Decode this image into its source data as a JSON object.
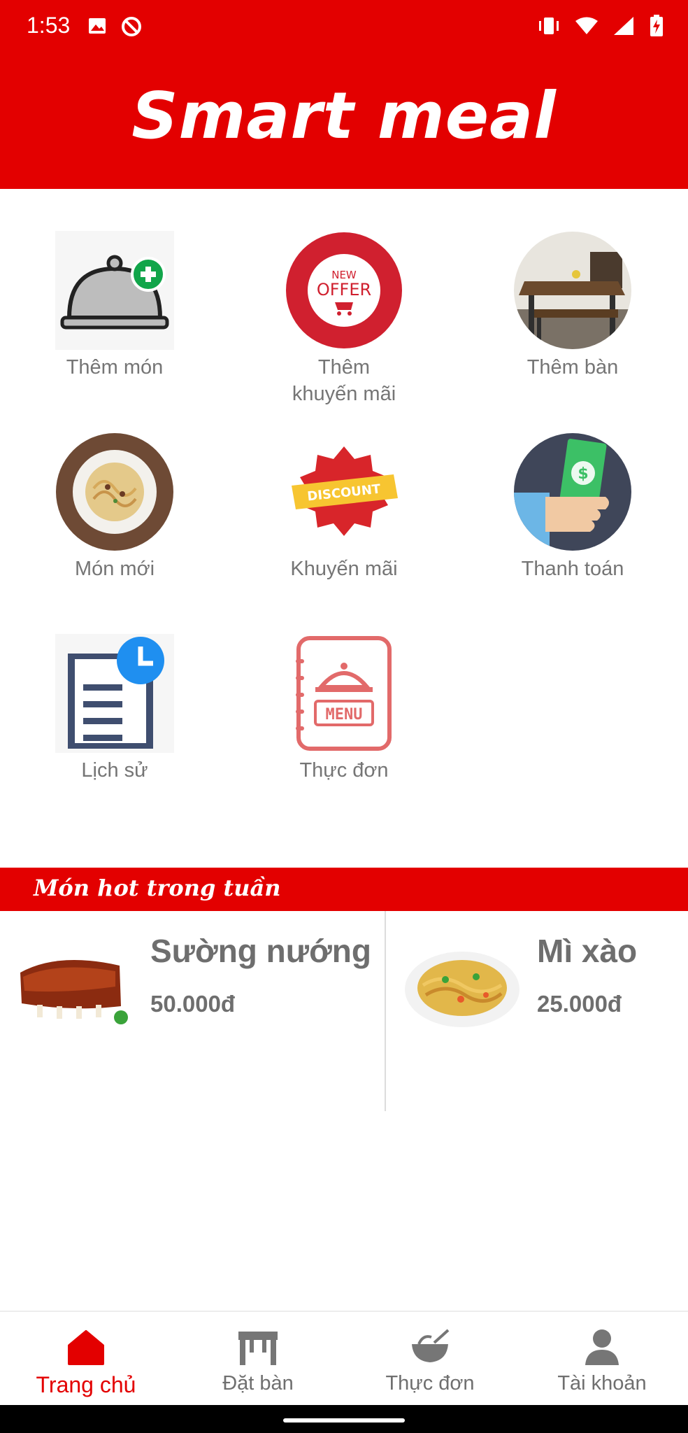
{
  "status": {
    "time": "1:53"
  },
  "app": {
    "title": "Smart meal"
  },
  "features": [
    {
      "label": "Thêm món",
      "icon": "covered-dish-add-icon"
    },
    {
      "label": "Thêm\nkhuyến mãi",
      "icon": "new-offer-icon"
    },
    {
      "label": "Thêm bàn",
      "icon": "dining-table-icon"
    },
    {
      "label": "Món mới",
      "icon": "noodle-plate-icon"
    },
    {
      "label": "Khuyến mãi",
      "icon": "discount-badge-icon"
    },
    {
      "label": "Thanh toán",
      "icon": "payment-cash-icon"
    },
    {
      "label": "Lịch sử",
      "icon": "history-document-icon"
    },
    {
      "label": "Thực đơn",
      "icon": "menu-book-icon"
    }
  ],
  "hot": {
    "title": "Món hot trong tuần",
    "items": [
      {
        "name": "Sường nướng",
        "price": "50.000đ"
      },
      {
        "name": "Mì xào",
        "price": "25.000đ"
      }
    ]
  },
  "nav": {
    "items": [
      {
        "label": "Trang chủ",
        "icon": "home-icon",
        "active": true
      },
      {
        "label": "Đặt bàn",
        "icon": "table-icon",
        "active": false
      },
      {
        "label": "Thực đơn",
        "icon": "bowl-icon",
        "active": false
      },
      {
        "label": "Tài khoản",
        "icon": "account-icon",
        "active": false
      }
    ]
  },
  "colors": {
    "brand": "#e30000",
    "text": "#757575"
  }
}
